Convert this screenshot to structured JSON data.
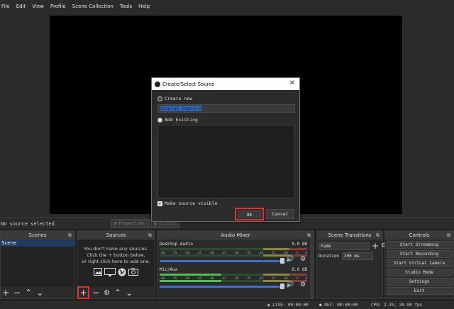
{
  "menu": [
    "File",
    "Edit",
    "View",
    "Profile",
    "Scene Collection",
    "Tools",
    "Help"
  ],
  "source_bar": {
    "no_source": "No source selected",
    "properties": "Properties",
    "filters": "Filters"
  },
  "docks": {
    "scenes": {
      "title": "Scenes",
      "items": [
        "Scene"
      ]
    },
    "sources": {
      "title": "Sources",
      "empty_lines": [
        "You don't have any sources.",
        "Click the + button below,",
        "or right click here to add one."
      ]
    },
    "mixer": {
      "title": "Audio Mixer",
      "ticks": [
        "-60",
        "-55",
        "-50",
        "-45",
        "-40",
        "-35",
        "-30",
        "-25",
        "-20",
        "-15",
        "-10",
        "-5",
        "0"
      ],
      "channels": [
        {
          "name": "Desktop Audio",
          "db": "0.0 dB",
          "level": 0.0
        },
        {
          "name": "Mic/Aux",
          "db": "0.0 dB",
          "level": 0.42
        }
      ]
    },
    "transitions": {
      "title": "Scene Transitions",
      "selected": "Fade",
      "duration_label": "Duration",
      "duration_value": "300 ms"
    },
    "controls": {
      "title": "Controls",
      "buttons": [
        "Start Streaming",
        "Start Recording",
        "Start Virtual Camera",
        "Studio Mode",
        "Settings",
        "Exit"
      ]
    }
  },
  "status": {
    "live": "LIVE: 00:00:00",
    "rec": "REC: 00:00:00",
    "cpu": "CPU: 2.3%, 30.00 fps"
  },
  "dialog": {
    "title": "Create/Select Source",
    "create_new": "Create new",
    "name_value": "Display Capture",
    "add_existing": "Add Existing",
    "make_visible": "Make source visible",
    "ok": "OK",
    "cancel": "Cancel"
  },
  "colors": {
    "accent": "#3366b0",
    "highlight": "#e03030",
    "meter_green": "#47c34a"
  }
}
